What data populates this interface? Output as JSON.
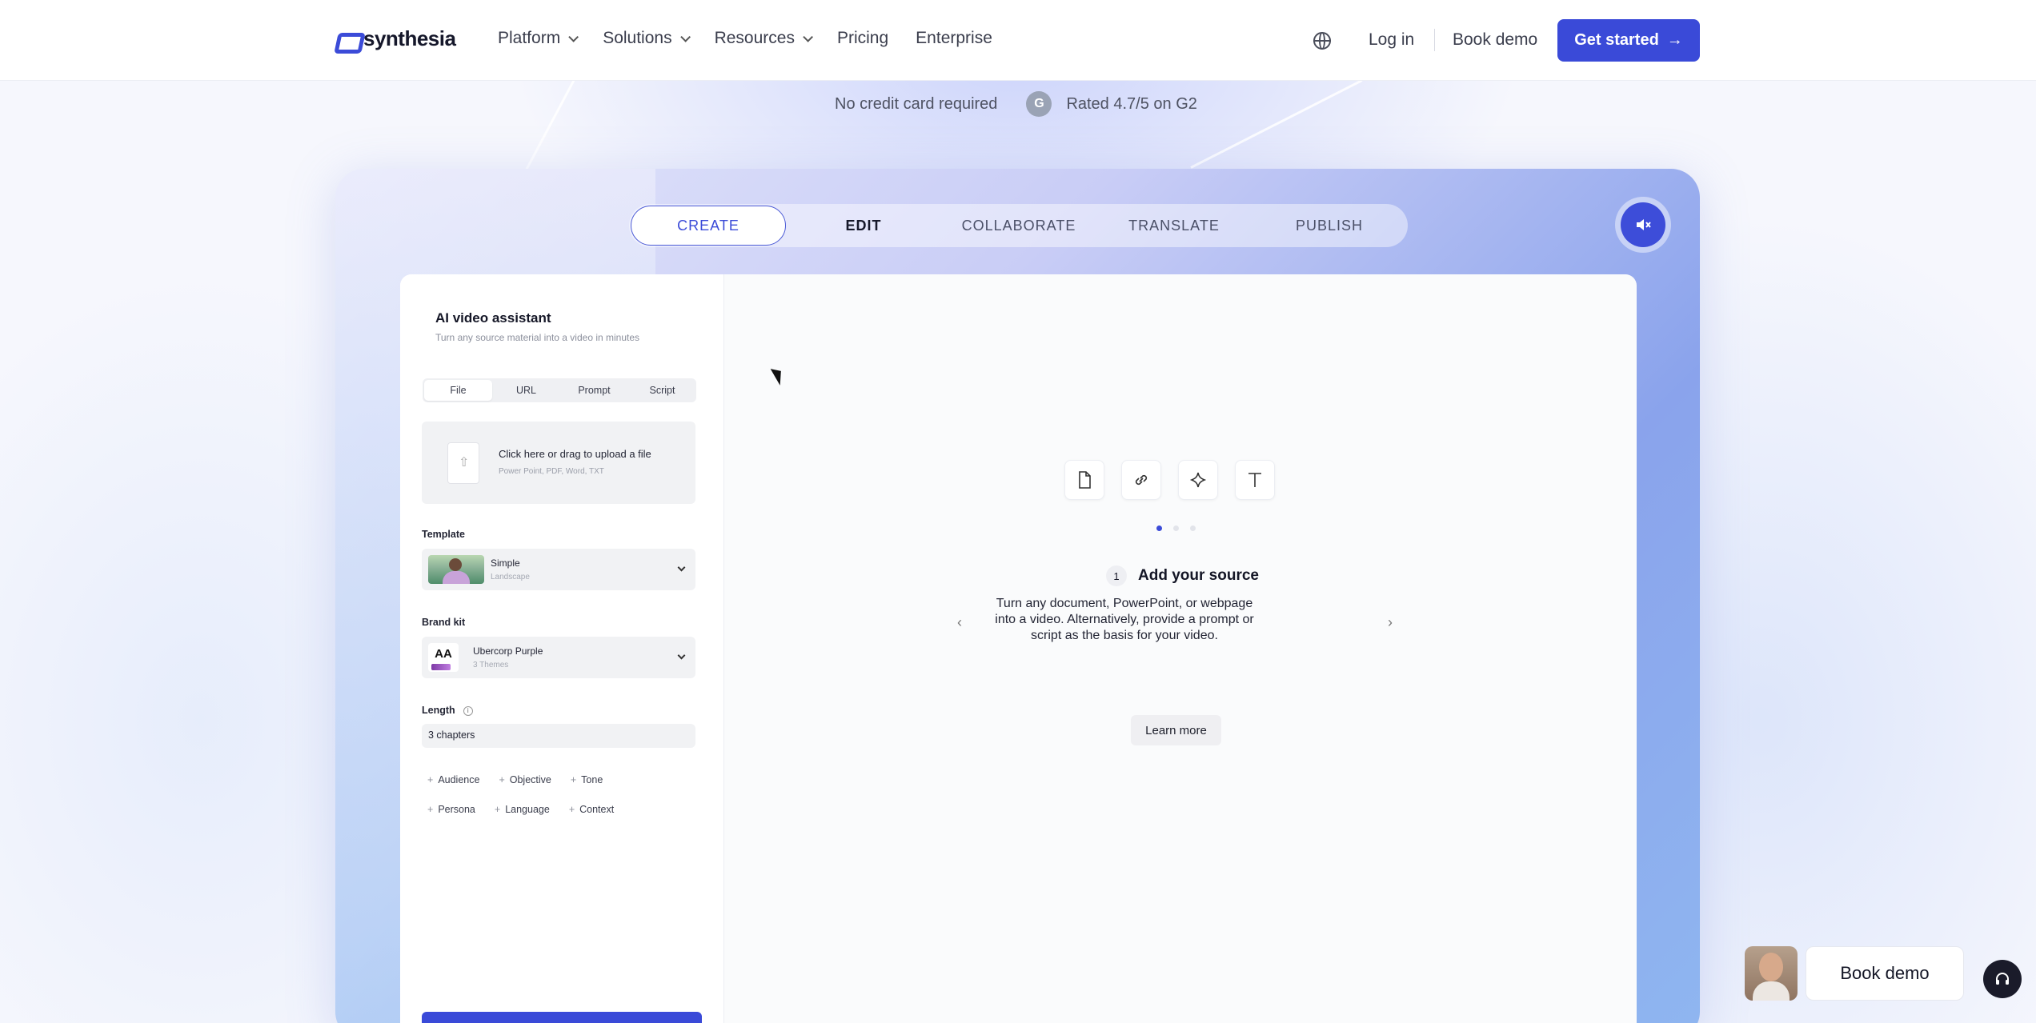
{
  "header": {
    "logo_text": "synthesia",
    "nav": [
      {
        "label": "Platform",
        "dropdown": true
      },
      {
        "label": "Solutions",
        "dropdown": true
      },
      {
        "label": "Resources",
        "dropdown": true
      },
      {
        "label": "Pricing",
        "dropdown": false
      },
      {
        "label": "Enterprise",
        "dropdown": false
      }
    ],
    "login": "Log in",
    "book_demo": "Book demo",
    "get_started": "Get started",
    "accent": "#3a4ad8"
  },
  "subline": {
    "no_card": "No credit card required",
    "rating": "Rated 4.7/5 on G2"
  },
  "tabs": [
    "CREATE",
    "EDIT",
    "COLLABORATE",
    "TRANSLATE",
    "PUBLISH"
  ],
  "assistant": {
    "title": "AI video assistant",
    "subtitle": "Turn any source material into a video in minutes",
    "source_tabs": [
      "File",
      "URL",
      "Prompt",
      "Script"
    ],
    "upload_title": "Click here or drag to upload a file",
    "upload_sub": "Power Point, PDF, Word, TXT",
    "template_label": "Template",
    "template_name": "Simple",
    "template_sub": "Landscape",
    "brand_label": "Brand kit",
    "brand_name": "Ubercorp Purple",
    "brand_sub": "3 Themes",
    "brand_initials": "AA",
    "length_label": "Length",
    "length_value": "3 chapters",
    "chips_row1": [
      "Audience",
      "Objective",
      "Tone"
    ],
    "chips_row2": [
      "Persona",
      "Language",
      "Context"
    ]
  },
  "main": {
    "source_icons": [
      "document-icon",
      "link-icon",
      "sparkle-icon",
      "text-icon"
    ],
    "step_num": "1",
    "step_title": "Add your source",
    "step_desc": "Turn any document, PowerPoint, or webpage into a video. Alternatively, provide a prompt or script as the basis for your video.",
    "learn_more": "Learn more"
  },
  "floating": {
    "book_demo": "Book demo"
  }
}
